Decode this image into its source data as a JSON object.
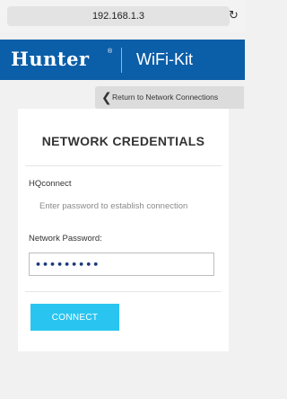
{
  "browser": {
    "url": "192.168.1.3",
    "reload_icon": "↻"
  },
  "header": {
    "brand": "Hunter",
    "brand_mark": "®",
    "product": "WiFi-Kit",
    "background_color": "#0b5ea8"
  },
  "nav": {
    "back_icon": "❮",
    "back_label": "Return to Network Connections"
  },
  "form": {
    "title": "NETWORK CREDENTIALS",
    "network_name": "HQconnect",
    "hint": "Enter password to establish connection",
    "password_label": "Network Password:",
    "password_value": "abcdefghi",
    "connect_label": "CONNECT",
    "accent_color": "#29c5f0"
  }
}
